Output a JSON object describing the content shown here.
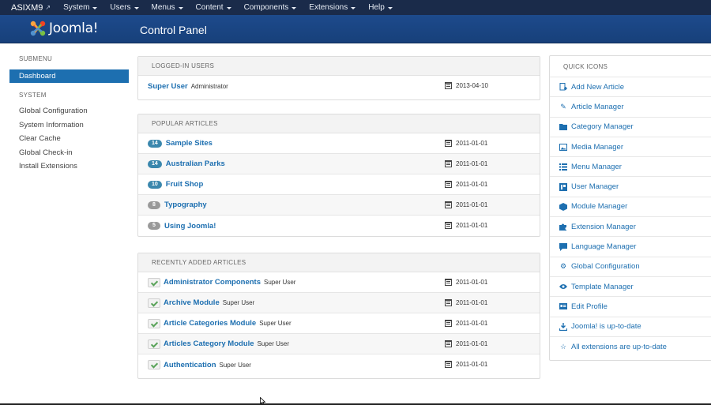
{
  "topbar": {
    "brand": "ASIXM9",
    "menu": [
      "System",
      "Users",
      "Menus",
      "Content",
      "Components",
      "Extensions",
      "Help"
    ]
  },
  "header": {
    "logo_text": "Joomla!",
    "title": "Control Panel"
  },
  "sidebar": {
    "submenu_heading": "SUBMENU",
    "active_item": "Dashboard",
    "system_heading": "SYSTEM",
    "items": [
      "Global Configuration",
      "System Information",
      "Clear Cache",
      "Global Check-in",
      "Install Extensions"
    ]
  },
  "logged_in": {
    "heading": "LOGGED-IN USERS",
    "rows": [
      {
        "name": "Super User",
        "role": "Administrator",
        "date": "2013-04-10"
      }
    ]
  },
  "popular": {
    "heading": "POPULAR ARTICLES",
    "rows": [
      {
        "hits": "14",
        "title": "Sample Sites",
        "date": "2011-01-01"
      },
      {
        "hits": "14",
        "title": "Australian Parks",
        "date": "2011-01-01"
      },
      {
        "hits": "10",
        "title": "Fruit Shop",
        "date": "2011-01-01"
      },
      {
        "hits": "8",
        "title": "Typography",
        "date": "2011-01-01"
      },
      {
        "hits": "5",
        "title": "Using Joomla!",
        "date": "2011-01-01"
      }
    ]
  },
  "recent": {
    "heading": "RECENTLY ADDED ARTICLES",
    "rows": [
      {
        "title": "Administrator Components",
        "author": "Super User",
        "date": "2011-01-01"
      },
      {
        "title": "Archive Module",
        "author": "Super User",
        "date": "2011-01-01"
      },
      {
        "title": "Article Categories Module",
        "author": "Super User",
        "date": "2011-01-01"
      },
      {
        "title": "Articles Category Module",
        "author": "Super User",
        "date": "2011-01-01"
      },
      {
        "title": "Authentication",
        "author": "Super User",
        "date": "2011-01-01"
      }
    ]
  },
  "quick_icons": {
    "heading": "QUICK ICONS",
    "items": [
      {
        "label": "Add New Article",
        "icon": "new-article-icon"
      },
      {
        "label": "Article Manager",
        "icon": "pencil-icon"
      },
      {
        "label": "Category Manager",
        "icon": "folder-icon"
      },
      {
        "label": "Media Manager",
        "icon": "image-icon"
      },
      {
        "label": "Menu Manager",
        "icon": "list-icon"
      },
      {
        "label": "User Manager",
        "icon": "user-icon"
      },
      {
        "label": "Module Manager",
        "icon": "cube-icon"
      },
      {
        "label": "Extension Manager",
        "icon": "puzzle-icon"
      },
      {
        "label": "Language Manager",
        "icon": "comment-icon"
      },
      {
        "label": "Global Configuration",
        "icon": "cog-icon"
      },
      {
        "label": "Template Manager",
        "icon": "eye-icon"
      },
      {
        "label": "Edit Profile",
        "icon": "vcard-icon"
      },
      {
        "label": "Joomla! is up-to-date",
        "icon": "download-icon"
      },
      {
        "label": "All extensions are up-to-date",
        "icon": "star-icon"
      }
    ]
  },
  "colors": {
    "link": "#1d6fb0",
    "topbar": "#1a2b4a",
    "header": "#1d4a8c",
    "active": "#1d6fb0"
  }
}
